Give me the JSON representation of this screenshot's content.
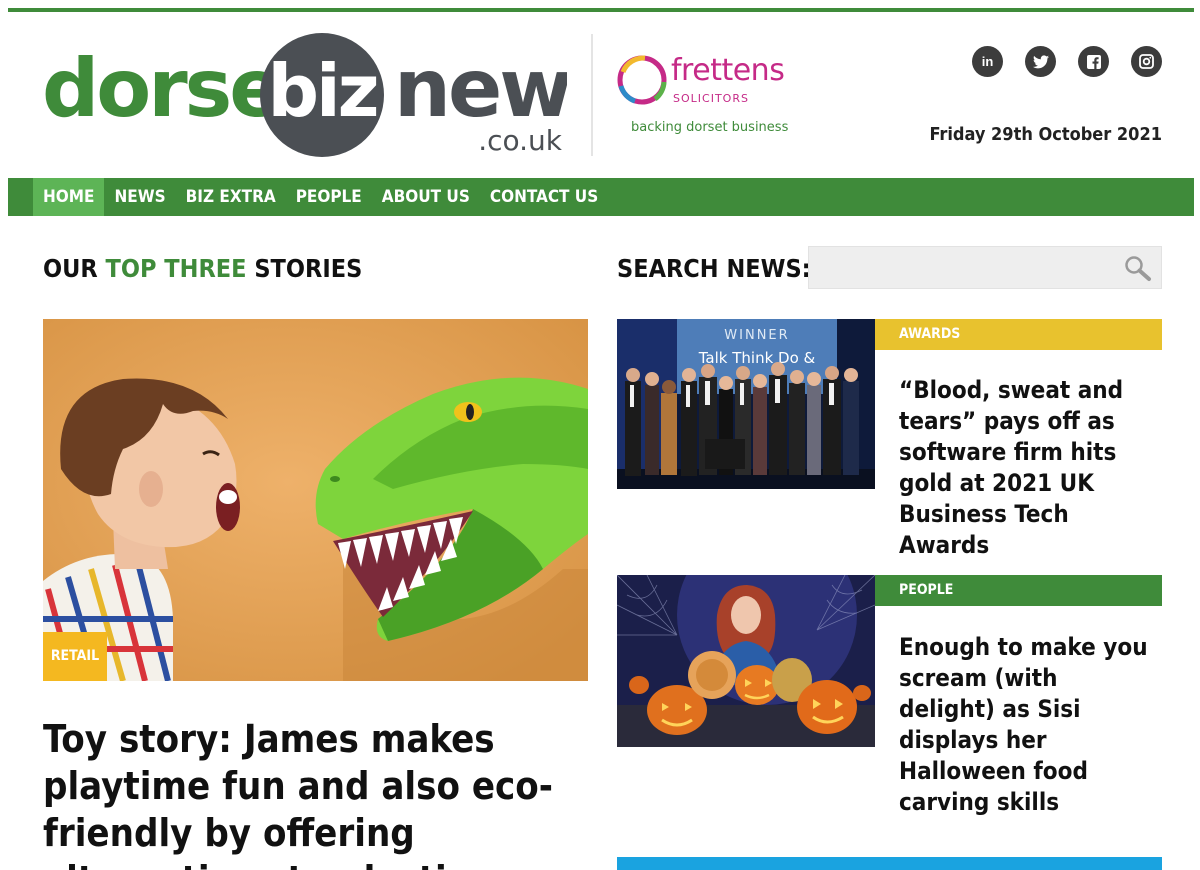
{
  "brand": {
    "logo_part1": "dorset",
    "logo_part2": "biz",
    "logo_part3": "news",
    "logo_suffix": ".co.uk",
    "green": "#3f8b3a",
    "dark": "#4b4f54"
  },
  "sponsor": {
    "name": "frettens",
    "sub": "SOLICITORS",
    "tagline": "backing dorset business",
    "color": "#c52a87"
  },
  "social": [
    {
      "label": "in",
      "icon": "linkedin-icon"
    },
    {
      "label": "t",
      "icon": "twitter-icon"
    },
    {
      "label": "f",
      "icon": "facebook-icon"
    },
    {
      "label": "ig",
      "icon": "instagram-icon"
    }
  ],
  "header": {
    "date": "Friday 29th October 2021"
  },
  "nav": {
    "items": [
      "HOME",
      "NEWS",
      "BIZ EXTRA",
      "PEOPLE",
      "ABOUT US",
      "CONTACT US"
    ],
    "active": "HOME"
  },
  "sections": {
    "top_prefix": "OUR ",
    "top_accent": "TOP THREE",
    "top_suffix": " STORIES",
    "search_label": "SEARCH NEWS:"
  },
  "search": {
    "placeholder": "",
    "value": ""
  },
  "lead_story": {
    "category": "RETAIL",
    "title": "Toy story: James makes playtime fun and also eco-friendly by offering alternatives to plastic"
  },
  "side_stories": [
    {
      "category": "AWARDS",
      "title": "“Blood, sweat and tears” pays off as software firm hits gold at 2021 UK Business Tech Awards",
      "screen_line1": "WINNER",
      "screen_line2": "Talk Think Do &"
    },
    {
      "category": "PEOPLE",
      "title": "Enough to make you scream (with delight) as Sisi displays her Halloween food carving skills"
    }
  ]
}
